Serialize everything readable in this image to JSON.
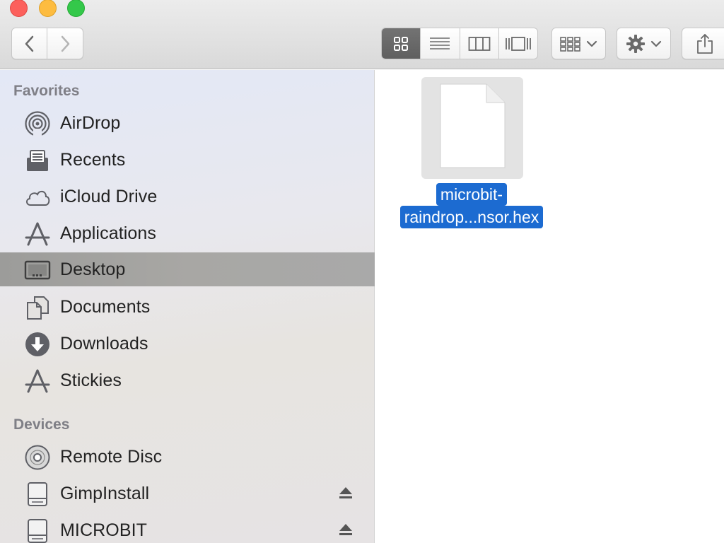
{
  "window": {
    "traffic_lights": {
      "close_color": "#fc605c",
      "minimize_color": "#fdbc40",
      "zoom_color": "#34c84a"
    }
  },
  "toolbar": {
    "back_icon": "chevron-left-icon",
    "forward_icon": "chevron-right-icon",
    "views": [
      {
        "icon": "icon-view-icon",
        "active": true
      },
      {
        "icon": "list-view-icon",
        "active": false
      },
      {
        "icon": "column-view-icon",
        "active": false
      },
      {
        "icon": "cover-flow-icon",
        "active": false
      }
    ],
    "arrange_icon": "arrange-grid-icon",
    "action_icon": "gear-icon",
    "share_icon": "share-icon"
  },
  "sidebar": {
    "favorites_header": "Favorites",
    "favorites": [
      {
        "label": "AirDrop",
        "icon": "airdrop-icon"
      },
      {
        "label": "Recents",
        "icon": "recents-icon"
      },
      {
        "label": "iCloud Drive",
        "icon": "cloud-icon"
      },
      {
        "label": "Applications",
        "icon": "applications-icon"
      },
      {
        "label": "Desktop",
        "icon": "desktop-icon",
        "selected": true
      },
      {
        "label": "Documents",
        "icon": "documents-icon"
      },
      {
        "label": "Downloads",
        "icon": "downloads-icon"
      },
      {
        "label": "Stickies",
        "icon": "applications-icon"
      }
    ],
    "devices_header": "Devices",
    "devices": [
      {
        "label": "Remote Disc",
        "icon": "disc-icon",
        "eject": false
      },
      {
        "label": "GimpInstall",
        "icon": "drive-icon",
        "eject": true
      },
      {
        "label": "MICROBIT",
        "icon": "drive-icon",
        "eject": true
      }
    ]
  },
  "content": {
    "files": [
      {
        "name_line1": "microbit-",
        "name_line2": "raindrop...nsor.hex",
        "icon": "document-icon",
        "selected": true
      }
    ]
  },
  "colors": {
    "selection_blue": "#1c6bd1",
    "sidebar_selected": "#a6a5a2",
    "section_header": "#7f7f86"
  }
}
